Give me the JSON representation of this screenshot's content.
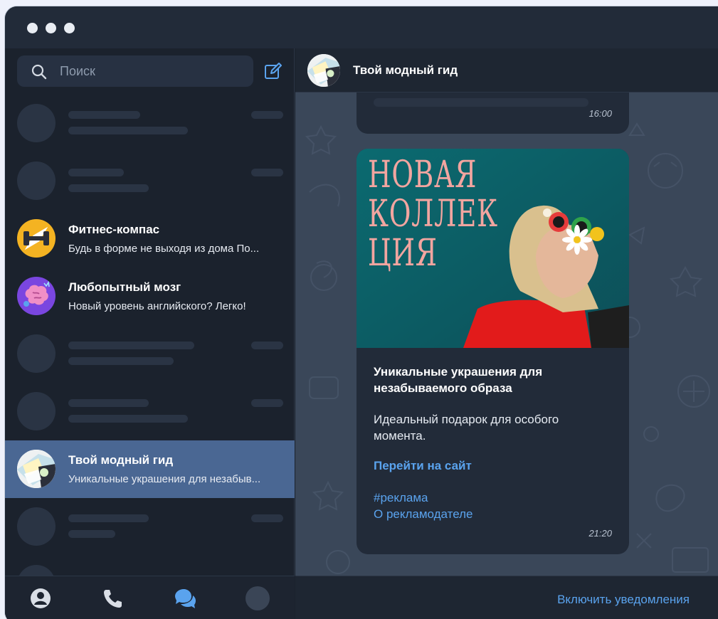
{
  "window": {
    "dots": 3
  },
  "sidebar": {
    "search": {
      "placeholder": "Поиск",
      "value": ""
    },
    "compose_icon": "edit-icon",
    "chats": [
      {
        "placeholder": true
      },
      {
        "placeholder": true
      },
      {
        "name": "Фитнес-компас",
        "preview": "Будь в форме не выходя из дома  По..."
      },
      {
        "name": "Любопытный мозг",
        "preview": "Новый уровень английского? Легко!"
      },
      {
        "placeholder": true
      },
      {
        "placeholder": true
      },
      {
        "name": "Твой модный гид",
        "preview": "Уникальные украшения для незабыв...",
        "active": true
      },
      {
        "placeholder": true
      },
      {
        "placeholder": true
      }
    ],
    "nav": [
      "profile-icon",
      "phone-icon",
      "chats-icon",
      "avatar"
    ]
  },
  "chat": {
    "title": "Твой модный гид",
    "messages": [
      {
        "time": "16:00"
      },
      {
        "image_text": [
          "НОВАЯ",
          "КОЛЛЕК",
          "ЦИЯ"
        ],
        "title": "Уникальные украшения для незабываемого образа",
        "body": "Идеальный подарок для особого момента.",
        "link": "Перейти на сайт",
        "hashtag": "#реклама",
        "advertiser": "О рекламодателе",
        "time": "21:20"
      }
    ],
    "footer_button": "Включить уведомления"
  },
  "colors": {
    "accent": "#5aa3ee",
    "active_row": "#4a6793",
    "background": "#1b222d"
  }
}
